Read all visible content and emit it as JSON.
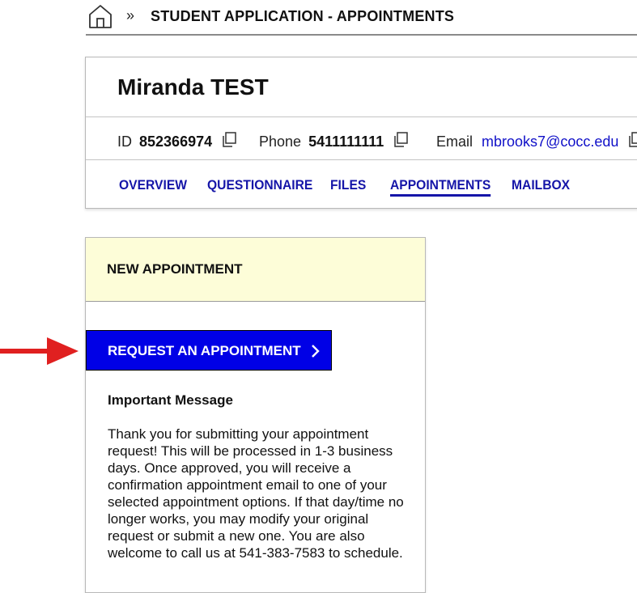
{
  "breadcrumb": {
    "separator": "»",
    "title": "STUDENT APPLICATION - APPOINTMENTS"
  },
  "person": {
    "name": "Miranda TEST",
    "id_label": "ID",
    "id_value": "852366974",
    "phone_label": "Phone",
    "phone_value": "5411111111",
    "email_label": "Email",
    "email_value": "mbrooks7@cocc.edu"
  },
  "tabs": [
    {
      "label": "OVERVIEW",
      "active": false
    },
    {
      "label": "QUESTIONNAIRE",
      "active": false
    },
    {
      "label": "FILES",
      "active": false
    },
    {
      "label": "APPOINTMENTS",
      "active": true
    },
    {
      "label": "MAILBOX",
      "active": false
    }
  ],
  "appointment": {
    "header": "NEW APPOINTMENT",
    "request_button": "REQUEST AN APPOINTMENT",
    "message_title": "Important Message",
    "message_body": "Thank you for submitting your appointment request! This will be processed in 1-3 business days. Once approved, you will receive a confirmation appointment email to one of your selected appointment options. If that day/time no longer works, you may modify your original request or submit a new one. You are also welcome to call us at 541-383-7583 to schedule."
  },
  "icons": {
    "home": "home-icon",
    "copy": "copy-icon",
    "chevron": "chevron-right-icon",
    "annotation": "red-arrow-icon"
  },
  "colors": {
    "link_blue": "#1515a8",
    "button_blue": "#0000e6",
    "header_yellow": "#fdfdd8",
    "arrow_red": "#e02020"
  }
}
